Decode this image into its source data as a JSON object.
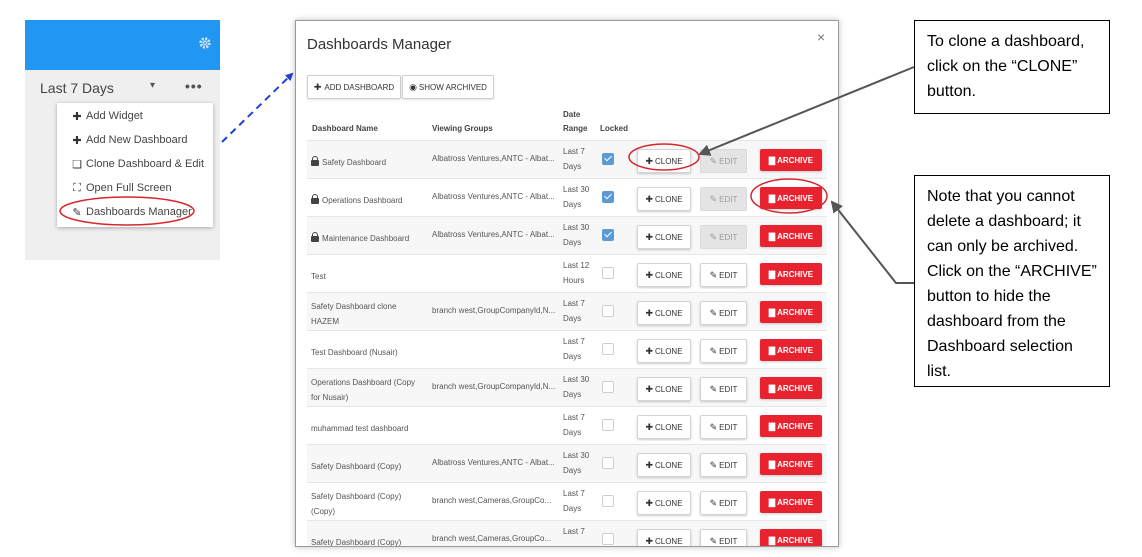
{
  "sidebar": {
    "range_label": "Last 7 Days",
    "caret": "▾",
    "more": "•••",
    "menu": [
      {
        "icon": "plus-icon",
        "glyph": "✚",
        "label": "Add Widget"
      },
      {
        "icon": "plus-icon",
        "glyph": "✚",
        "label": "Add New Dashboard"
      },
      {
        "icon": "clone-icon",
        "glyph": "❏",
        "label": "Clone Dashboard & Edit"
      },
      {
        "icon": "fullscreen-icon",
        "glyph": "⛶",
        "label": "Open Full Screen"
      },
      {
        "icon": "edit-icon",
        "glyph": "✎",
        "label": "Dashboards Manager"
      }
    ]
  },
  "dialog": {
    "title": "Dashboards Manager",
    "close": "×",
    "add_button": "ADD DASHBOARD",
    "show_archived_button": "SHOW ARCHIVED",
    "columns": {
      "name": "Dashboard Name",
      "groups": "Viewing Groups",
      "range_line1": "Date",
      "range_line2": "Range",
      "locked": "Locked"
    },
    "clone_label": "CLONE",
    "edit_label": "EDIT",
    "archive_label": "ARCHIVE",
    "rows": [
      {
        "name": "Safety Dashboard",
        "groups": "Albatross Ventures,ANTC - Albat...",
        "range1": "Last 7",
        "range2": "Days",
        "locked": true
      },
      {
        "name": "Operations Dashboard",
        "groups": "Albatross Ventures,ANTC - Albat...",
        "range1": "Last 30",
        "range2": "Days",
        "locked": true
      },
      {
        "name": "Maintenance Dashboard",
        "groups": "Albatross Ventures,ANTC - Albat...",
        "range1": "Last 30",
        "range2": "Days",
        "locked": true
      },
      {
        "name": "Test",
        "groups": "",
        "range1": "Last 12",
        "range2": "Hours",
        "locked": false
      },
      {
        "name": "Safety Dashboard clone HAZEM",
        "groups": "branch west,GroupCompanyId,N...",
        "range1": "Last 7",
        "range2": "Days",
        "locked": false
      },
      {
        "name": "Test Dashboard (Nusair)",
        "groups": "",
        "range1": "Last 7",
        "range2": "Days",
        "locked": false
      },
      {
        "name": "Operations Dashboard (Copy for Nusair)",
        "groups": "branch west,GroupCompanyId,N...",
        "range1": "Last 30",
        "range2": "Days",
        "locked": false
      },
      {
        "name": "muhammad test dashboard",
        "groups": "",
        "range1": "Last 7",
        "range2": "Days",
        "locked": false
      },
      {
        "name": "Safety Dashboard (Copy)",
        "groups": "Albatross Ventures,ANTC - Albat...",
        "range1": "Last 30",
        "range2": "Days",
        "locked": false
      },
      {
        "name": "Safety Dashboard (Copy) (Copy)",
        "groups": "branch west,Cameras,GroupCo...",
        "range1": "Last 7",
        "range2": "Days",
        "locked": false
      },
      {
        "name": "Safety Dashboard (Copy)",
        "groups": "branch west,Cameras,GroupCo...",
        "range1": "Last 7",
        "range2": "",
        "locked": false
      }
    ]
  },
  "callouts": {
    "clone": "To clone a dashboard, click on the “CLONE” button.",
    "archive": "Note that you cannot delete a dashboard; it can only be archived. Click on the “ARCHIVE” button to hide the dashboard from the Dashboard selection list."
  },
  "colors": {
    "header_blue": "#2196f3",
    "archive_red": "#e8222e",
    "annotation_red": "#d9262c",
    "arrow_blue": "#1f3fd8"
  }
}
